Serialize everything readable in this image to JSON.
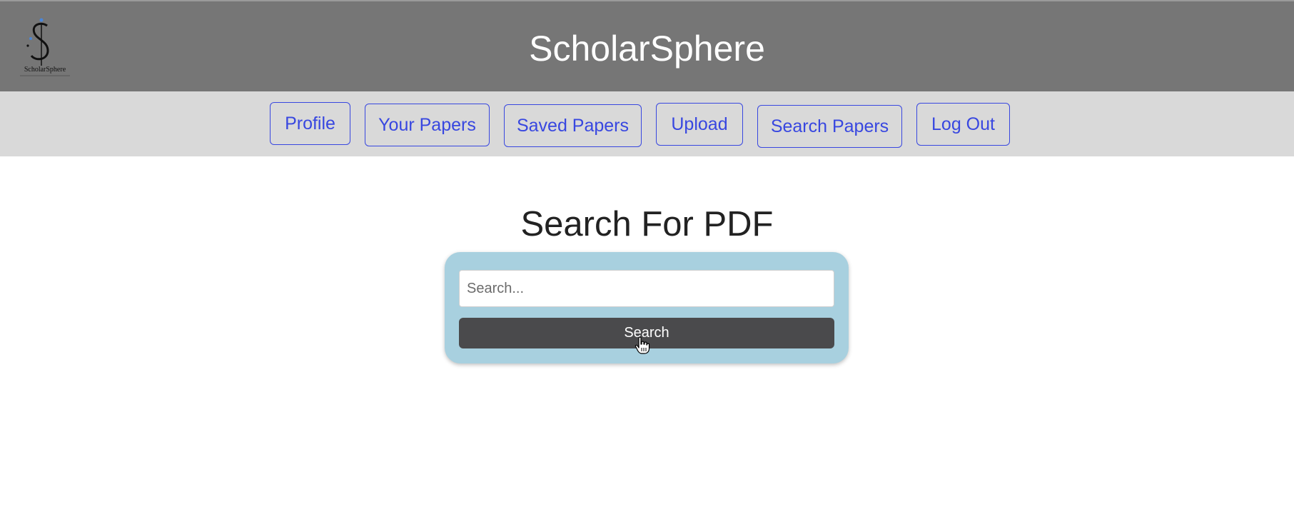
{
  "header": {
    "title": "ScholarSphere",
    "logo": {
      "icon": "scholarsphere-logo",
      "text": "ScholarSphere",
      "accent_color": "#4a86d8"
    },
    "background": "#767676"
  },
  "nav": {
    "items": [
      {
        "label": "Profile"
      },
      {
        "label": "Your Papers"
      },
      {
        "label": "Saved Papers"
      },
      {
        "label": "Upload"
      },
      {
        "label": "Search Papers"
      },
      {
        "label": "Log Out"
      }
    ],
    "accent_color": "#3847e0",
    "background": "#d9d9d9"
  },
  "main": {
    "heading": "Search For PDF",
    "search": {
      "placeholder": "Search...",
      "value": "",
      "button_label": "Search",
      "card_color": "#a8d0df",
      "button_color": "#4a4a4c"
    }
  }
}
